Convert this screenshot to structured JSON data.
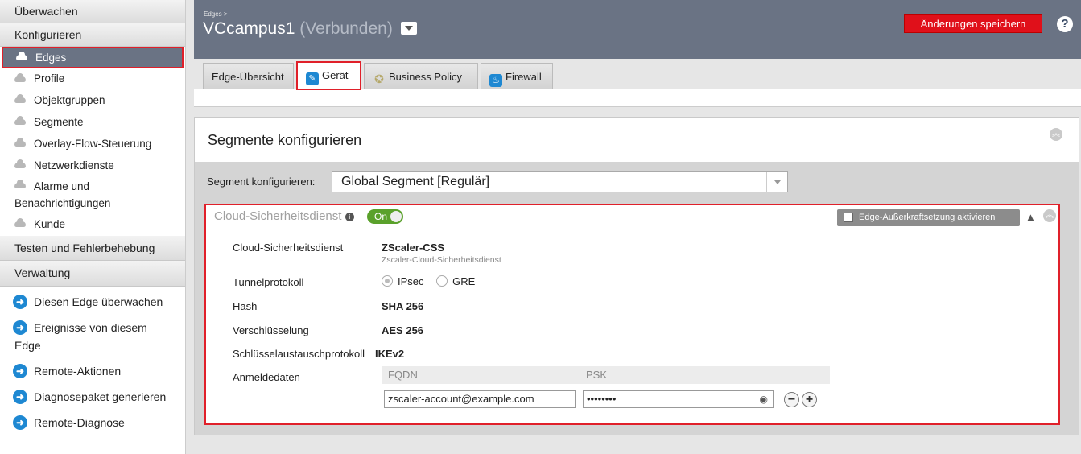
{
  "sidebar": {
    "sections": {
      "monitor": "Überwachen",
      "configure": "Konfigurieren",
      "test": "Testen und Fehlerbehebung",
      "admin": "Verwaltung"
    },
    "configure_items": [
      "Edges",
      "Profile",
      "Objektgruppen",
      "Segmente",
      "Overlay-Flow-Steuerung",
      "Netzwerkdienste",
      "Alarme und",
      "Benachrichtigungen",
      "Kunde"
    ],
    "actions": [
      "Diesen Edge überwachen",
      "Ereignisse von diesem",
      "Edge",
      "Remote-Aktionen",
      "Diagnosepaket generieren",
      "Remote-Diagnose"
    ]
  },
  "header": {
    "breadcrumb": "Edges >",
    "edge_name": "VCcampus1",
    "edge_status": "(Verbunden)",
    "save_label": "Änderungen speichern",
    "help_glyph": "?"
  },
  "tabs": [
    "Edge-Übersicht",
    "Gerät",
    "Business Policy",
    "Firewall"
  ],
  "panel": {
    "title": "Segmente konfigurieren",
    "segment_label": "Segment konfigurieren:",
    "segment_value": "Global Segment [Regulär]"
  },
  "css": {
    "title": "Cloud-Sicherheitsdienst",
    "toggle": "On",
    "override_label": "Edge-Außerkraftsetzung aktivieren",
    "rows": {
      "service_label": "Cloud-Sicherheitsdienst",
      "service_value": "ZScaler-CSS",
      "service_sub": "Zscaler-Cloud-Sicherheitsdienst",
      "tunnel_label": "Tunnelprotokoll",
      "tunnel_opt1": "IPsec",
      "tunnel_opt2": "GRE",
      "hash_label": "Hash",
      "hash_value": "SHA 256",
      "enc_label": "Verschlüsselung",
      "enc_value": "AES 256",
      "ike_label": "Schlüsselaustauschprotokoll",
      "ike_value": "IKEv2",
      "cred_label": "Anmeldedaten"
    },
    "credentials": {
      "col_fqdn": "FQDN",
      "col_psk": "PSK",
      "fqdn_value": "zscaler-account@example.com",
      "psk_value": "••••••••",
      "minus": "−",
      "plus": "+"
    }
  },
  "colors": {
    "header_bg": "#6a7384",
    "save_button": "#e0101a",
    "highlight_border": "#e0202a",
    "toggle_on": "#5aa12b",
    "action_arrow": "#1e88d2"
  }
}
